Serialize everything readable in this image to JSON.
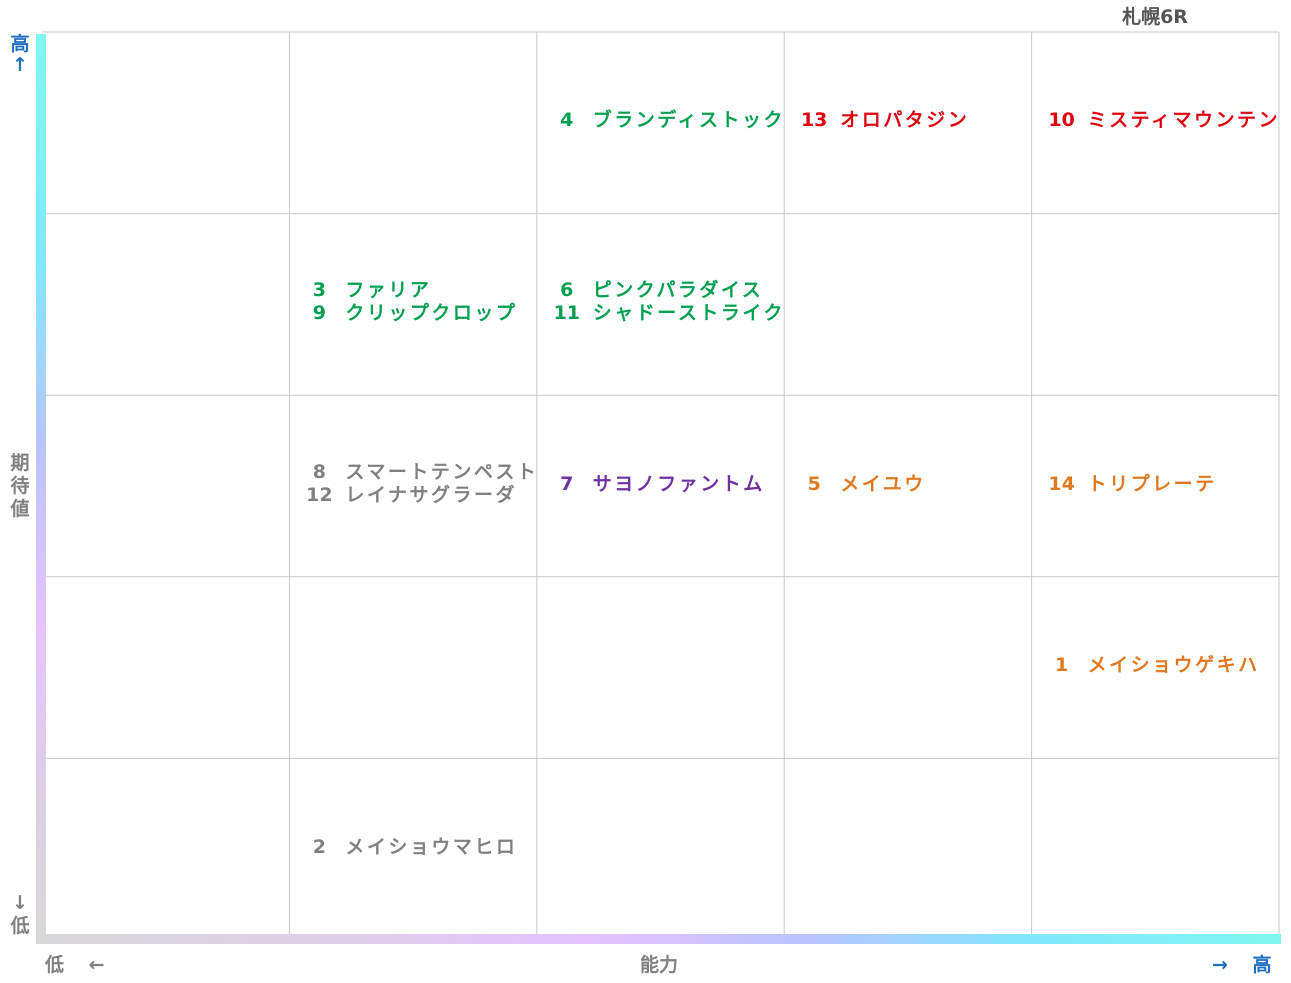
{
  "chart_data": {
    "type": "scatter",
    "title": "札幌6R",
    "y_axis": {
      "label": "期待値",
      "high": "高↑",
      "low": "↓低"
    },
    "x_axis": {
      "label": "能力",
      "low": "低 ←",
      "high": "→ 高"
    },
    "grid": {
      "columns": 5,
      "rows": 5
    },
    "colors": {
      "green": "#00a050",
      "red": "#e00010",
      "gray": "#808080",
      "purple": "#7030a0",
      "orange": "#e07820",
      "axis_blue": "#1f6ec0"
    },
    "cells": [
      {
        "col": 3,
        "row": 5,
        "color": "green",
        "entries": [
          {
            "num": "4",
            "name": "ブランディストック"
          }
        ]
      },
      {
        "col": 4,
        "row": 5,
        "color": "red",
        "entries": [
          {
            "num": "13",
            "name": "オロパタジン"
          }
        ]
      },
      {
        "col": 5,
        "row": 5,
        "color": "red",
        "entries": [
          {
            "num": "10",
            "name": "ミスティマウンテン"
          }
        ]
      },
      {
        "col": 2,
        "row": 4,
        "color": "green",
        "entries": [
          {
            "num": "3",
            "name": "ファリア"
          },
          {
            "num": "9",
            "name": "クリップクロップ"
          }
        ]
      },
      {
        "col": 3,
        "row": 4,
        "color": "green",
        "entries": [
          {
            "num": "6",
            "name": "ピンクパラダイス"
          },
          {
            "num": "11",
            "name": "シャドーストライク"
          }
        ]
      },
      {
        "col": 2,
        "row": 3,
        "color": "gray",
        "entries": [
          {
            "num": "8",
            "name": "スマートテンペスト"
          },
          {
            "num": "12",
            "name": "レイナサグラーダ"
          }
        ]
      },
      {
        "col": 3,
        "row": 3,
        "color": "purple",
        "entries": [
          {
            "num": "7",
            "name": "サヨノファントム"
          }
        ]
      },
      {
        "col": 4,
        "row": 3,
        "color": "orange",
        "entries": [
          {
            "num": "5",
            "name": "メイユウ"
          }
        ]
      },
      {
        "col": 5,
        "row": 3,
        "color": "orange",
        "entries": [
          {
            "num": "14",
            "name": "トリプレーテ"
          }
        ]
      },
      {
        "col": 5,
        "row": 2,
        "color": "orange",
        "entries": [
          {
            "num": "1",
            "name": "メイショウゲキハ"
          }
        ]
      },
      {
        "col": 2,
        "row": 1,
        "color": "gray",
        "entries": [
          {
            "num": "2",
            "name": "メイショウマヒロ"
          }
        ]
      }
    ]
  }
}
